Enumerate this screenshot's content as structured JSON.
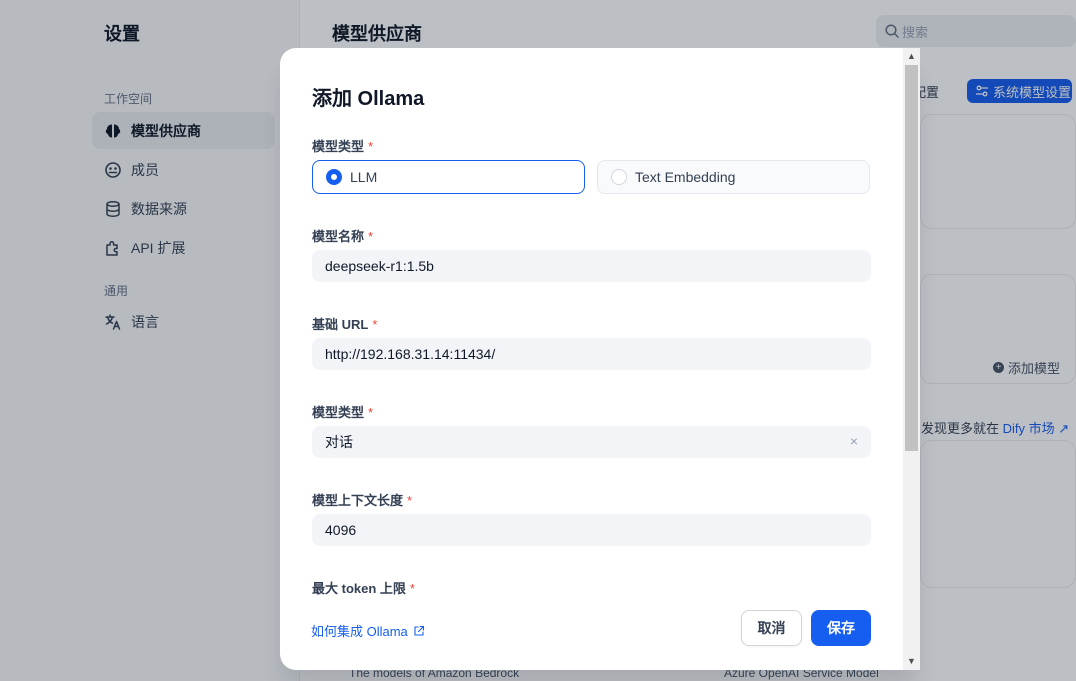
{
  "sidebar": {
    "title": "设置",
    "workspace_label": "工作空间",
    "items": [
      {
        "label": "模型供应商",
        "icon": "brain-icon",
        "active": true
      },
      {
        "label": "成员",
        "icon": "members-icon"
      },
      {
        "label": "数据来源",
        "icon": "database-icon"
      },
      {
        "label": "API 扩展",
        "icon": "puzzle-icon"
      }
    ],
    "general_label": "通用",
    "general_items": [
      {
        "label": "语言",
        "icon": "translate-icon"
      }
    ]
  },
  "main": {
    "title": "模型供应商",
    "search_placeholder": "搜索",
    "config_label": "全配置",
    "system_settings_label": "系统模型设置",
    "add_model_label": "添加模型",
    "discover_prefix": "发现更多就在",
    "discover_link": "Dify 市场",
    "bedrock_desc": "The models of Amazon Bedrock",
    "azure_desc": "Azure OpenAI Service Model"
  },
  "modal": {
    "title": "添加 Ollama",
    "model_type_label": "模型类型",
    "model_type_options": [
      "LLM",
      "Text Embedding"
    ],
    "model_type_selected": "LLM",
    "model_name_label": "模型名称",
    "model_name_value": "deepseek-r1:1.5b",
    "base_url_label": "基础 URL",
    "base_url_value": "http://192.168.31.14:11434/",
    "model_kind_label": "模型类型",
    "model_kind_value": "对话",
    "context_length_label": "模型上下文长度",
    "context_length_value": "4096",
    "max_token_label": "最大 token 上限",
    "required_mark": "*",
    "help_link": "如何集成 Ollama",
    "cancel_label": "取消",
    "save_label": "保存"
  },
  "colors": {
    "primary": "#155eef",
    "required": "#f04438"
  }
}
